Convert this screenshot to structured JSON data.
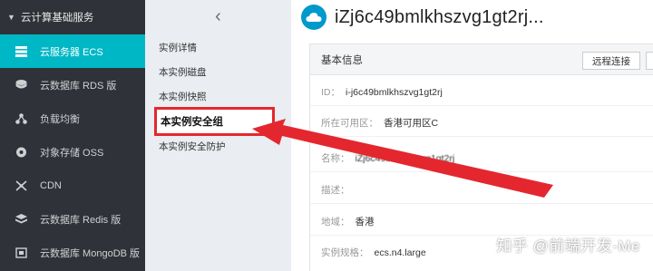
{
  "nav": {
    "header": "云计算基础服务",
    "items": [
      {
        "label": "云服务器 ECS",
        "icon": "server-icon"
      },
      {
        "label": "云数据库 RDS 版",
        "icon": "database-icon"
      },
      {
        "label": "负载均衡",
        "icon": "load-balancer-icon"
      },
      {
        "label": "对象存储 OSS",
        "icon": "storage-icon"
      },
      {
        "label": "CDN",
        "icon": "cdn-icon"
      },
      {
        "label": "云数据库 Redis 版",
        "icon": "redis-icon"
      },
      {
        "label": "云数据库 MongoDB 版",
        "icon": "mongodb-icon"
      }
    ]
  },
  "subnav": {
    "items": [
      "实例详情",
      "本实例磁盘",
      "本实例快照",
      "本实例安全组",
      "本实例安全防护"
    ]
  },
  "main": {
    "title": "iZj6c49bmlkhszvg1gt2rj...",
    "panel_title": "基本信息",
    "buttons": [
      "远程连接"
    ],
    "fields": [
      {
        "label": "ID：",
        "value": "i-j6c49bmlkhszvg1gt2rj"
      },
      {
        "label": "所在可用区：",
        "value": "香港可用区C"
      },
      {
        "label": "名称：",
        "value": "iZj6c49bmlkhszvg1gt2rj"
      },
      {
        "label": "描述：",
        "value": ""
      },
      {
        "label": "地域：",
        "value": "香港"
      },
      {
        "label": "实例规格：",
        "value": "ecs.n4.large"
      }
    ]
  },
  "watermark": "知乎 @前端开发-Me",
  "colors": {
    "nav_bg": "#2f3238",
    "accent": "#00b7c6",
    "highlight": "#e4272e"
  }
}
